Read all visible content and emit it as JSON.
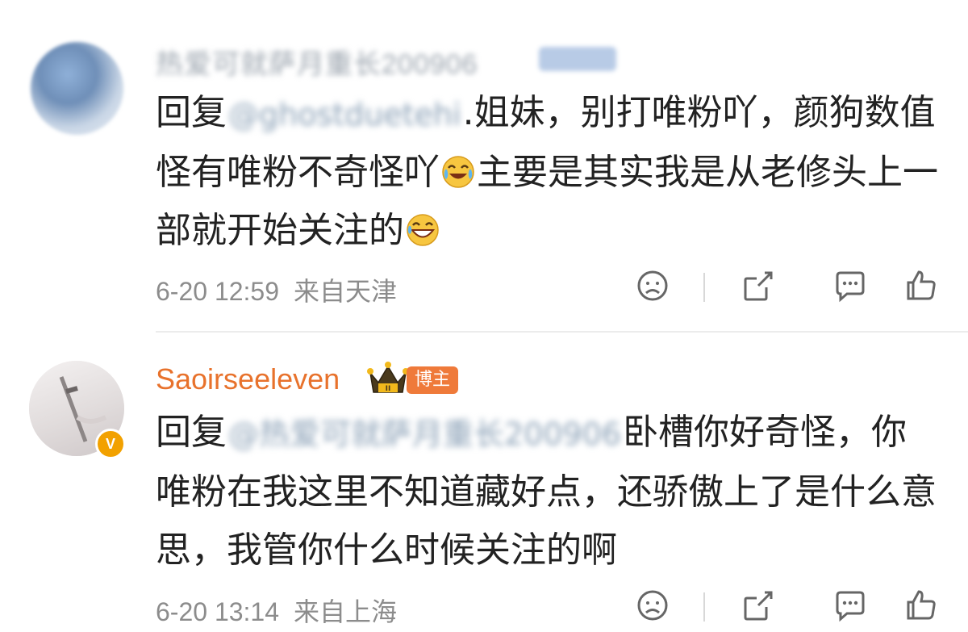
{
  "comments": [
    {
      "username": "热爱可就萨月重长200906",
      "reply_prefix": "回复",
      "mention": "@ghostduetehi",
      "text_before_emoji": ".姐妹，别打唯粉吖，颜狗数值怪有唯粉不奇怪吖",
      "emoji_1": "laugh-cry-emoji",
      "text_middle": "主要是其实我是从老修头上一部就开始关注的",
      "emoji_2": "grin-sweat-emoji",
      "date": "6-20 12:59",
      "location": "来自天津",
      "actions": [
        "dislike-icon",
        "share-icon",
        "comment-icon",
        "like-icon"
      ]
    },
    {
      "username": "Saoirseeleven",
      "badge": "博主",
      "verified": "V",
      "reply_prefix": "回复",
      "mention": "@热爱可就萨月重长200906",
      "text": "卧槽你好奇怪，你唯粉在我这里不知道藏好点，还骄傲上了是什么意思，我管你什么时候关注的啊",
      "date": "6-20 13:14",
      "location": "来自上海",
      "actions": [
        "dislike-icon",
        "share-icon",
        "comment-icon",
        "like-icon"
      ]
    }
  ],
  "colors": {
    "username_highlight": "#e8722c",
    "badge_bg": "#ef7a3a",
    "verified_bg": "#f2a100",
    "meta_text": "#8c8c8c"
  }
}
